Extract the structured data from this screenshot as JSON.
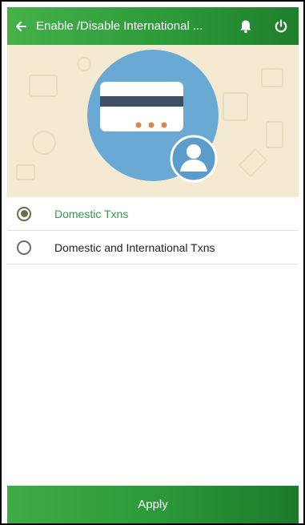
{
  "app_bar": {
    "title": "Enable /Disable International ...",
    "back_icon": "arrow-left-icon",
    "notification_icon": "bell-icon",
    "power_icon": "power-icon",
    "background_color": "#2c9a3a"
  },
  "banner": {
    "illustration": "card-with-user-illustration",
    "background_color": "#f4ead1",
    "circle_color": "#6aa9d4"
  },
  "options": [
    {
      "label": "Domestic Txns",
      "selected": true
    },
    {
      "label": "Domestic and International Txns",
      "selected": false
    }
  ],
  "footer": {
    "apply_label": "Apply"
  },
  "colors": {
    "accent_green": "#2e9b4a",
    "card_white": "#ffffff",
    "card_stripe": "#3e4f63",
    "card_dots": "#d9874f"
  }
}
